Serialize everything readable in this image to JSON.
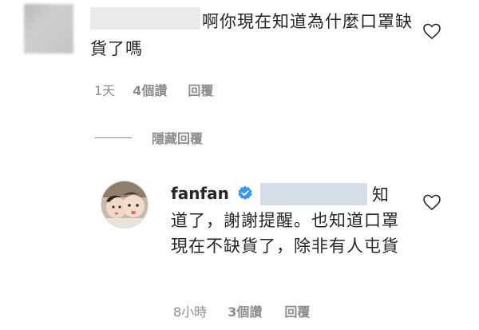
{
  "comment": {
    "text": "啊你現在知道為什麼口罩缺貨了嗎",
    "time": "1天",
    "likes": "4個讚",
    "reply_label": "回覆",
    "avatar_icon": "avatar-icon",
    "like_icon": "heart-icon"
  },
  "replies_toggle": {
    "label": "隱藏回覆"
  },
  "reply": {
    "username": "fanfan",
    "verified_icon": "verified-badge-icon",
    "first_char": "知",
    "text": "道了，謝謝提醒。也知道口罩現在不缺貨了，除非有人屯貨",
    "time": "8小時",
    "likes": "3個讚",
    "reply_label": "回覆",
    "avatar_icon": "avatar-icon",
    "like_icon": "heart-icon"
  },
  "colors": {
    "text": "#262626",
    "meta": "#8e8e8e",
    "verified": "#3897f0"
  }
}
